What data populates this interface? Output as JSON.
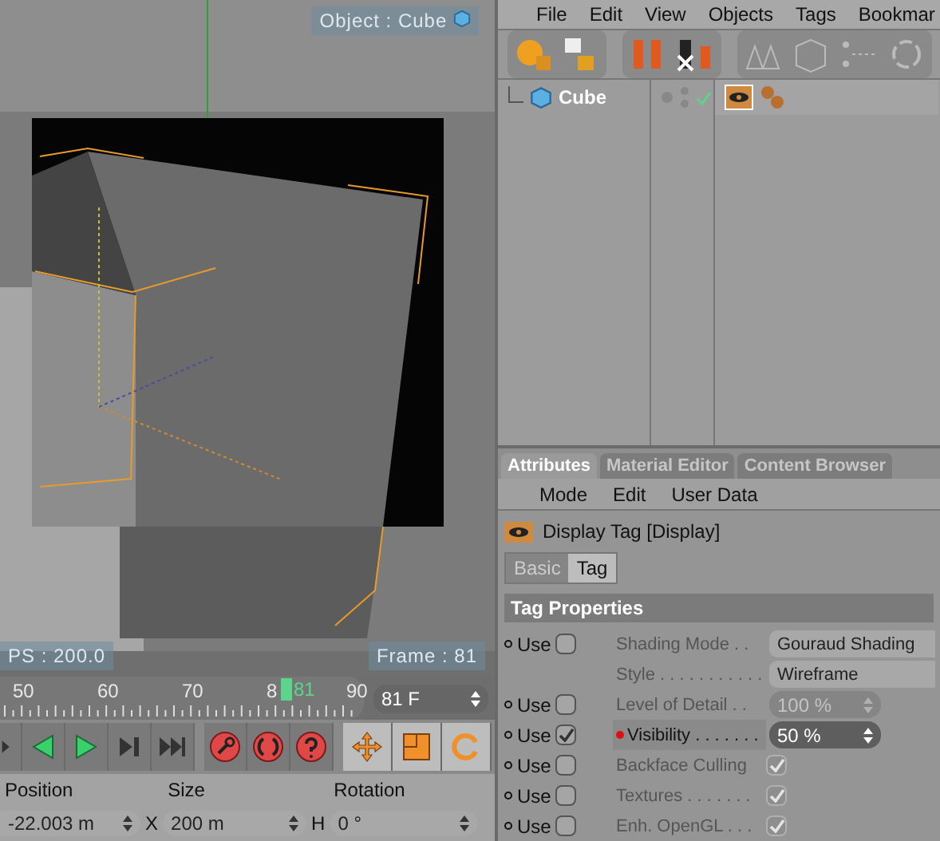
{
  "viewport": {
    "object_label": "Object : Cube",
    "fps_label": "PS : 200.0",
    "frame_label": "Frame : 81"
  },
  "timeline": {
    "ticks": [
      "50",
      "60",
      "70",
      "8",
      "90"
    ],
    "current": "81",
    "frame_field": "81 F"
  },
  "transport": {
    "buttons": [
      {
        "kind": "prev"
      },
      {
        "kind": "back"
      },
      {
        "kind": "play"
      },
      {
        "kind": "next"
      },
      {
        "kind": "end"
      }
    ],
    "keys": [
      {
        "kind": "key"
      },
      {
        "kind": "auto"
      },
      {
        "kind": "help"
      }
    ],
    "tools": [
      {
        "kind": "move",
        "selected": false
      },
      {
        "kind": "scale",
        "selected": false
      },
      {
        "kind": "rotate",
        "selected": false
      }
    ]
  },
  "coordinates": {
    "headers": [
      "Position",
      "Size",
      "Rotation"
    ],
    "values": [
      {
        "value": "-22.003 m"
      },
      {
        "axis": "X",
        "value": "200 m"
      },
      {
        "axis": "H",
        "value": "0 °"
      }
    ]
  },
  "menubar": [
    "File",
    "Edit",
    "View",
    "Objects",
    "Tags",
    "Bookmar"
  ],
  "objects": [
    {
      "name": "Cube",
      "checked": true
    }
  ],
  "tabs": [
    {
      "label": "Attributes",
      "selected": true
    },
    {
      "label": "Material Editor",
      "selected": false
    },
    {
      "label": "Content Browser",
      "selected": false
    }
  ],
  "attr_menu": [
    "Mode",
    "Edit",
    "User Data"
  ],
  "tag_title": "Display Tag [Display]",
  "subtabs": [
    {
      "label": "Basic",
      "selected": false
    },
    {
      "label": "Tag",
      "selected": true
    }
  ],
  "section": "Tag Properties",
  "properties": [
    {
      "use": {
        "label": "Use",
        "checked": false
      },
      "label": "Shading Mode . .",
      "kind": "dropdown",
      "value": "Gouraud Shading",
      "disabled": false,
      "keyframe": false
    },
    {
      "label": "Style . . . . . . . . . . .",
      "kind": "dropdown",
      "value": "Wireframe",
      "disabled": false,
      "keyframe": false
    },
    {
      "use": {
        "label": "Use",
        "checked": false
      },
      "label": "Level of Detail . .",
      "kind": "number",
      "value": "100 %",
      "disabled": true,
      "keyframe": false
    },
    {
      "use": {
        "label": "Use",
        "checked": true
      },
      "label": "Visibility . . . . . . .",
      "kind": "number",
      "value": "50 %",
      "disabled": false,
      "keyframe": true
    },
    {
      "use": {
        "label": "Use",
        "checked": false
      },
      "label": "Backface Culling",
      "kind": "checkbox",
      "checked": true,
      "disabled": true,
      "keyframe": false
    },
    {
      "use": {
        "label": "Use",
        "checked": false
      },
      "label": "Textures . . . . . . .",
      "kind": "checkbox",
      "checked": true,
      "disabled": true,
      "keyframe": false
    },
    {
      "use": {
        "label": "Use",
        "checked": false
      },
      "label": "Enh. OpenGL . . .",
      "kind": "checkbox",
      "checked": true,
      "disabled": true,
      "keyframe": false
    }
  ]
}
